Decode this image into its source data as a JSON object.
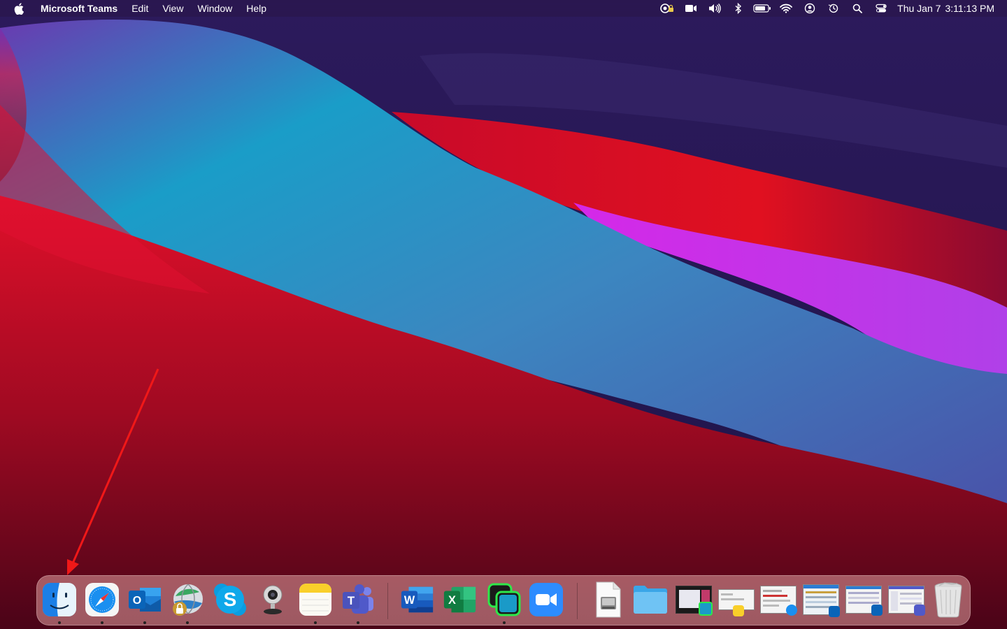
{
  "menubar": {
    "app_name": "Microsoft Teams",
    "menus": [
      "Edit",
      "View",
      "Window",
      "Help"
    ],
    "clock_day": "Thu Jan 7",
    "clock_time": "3:11:13 PM",
    "status_icons": [
      "teams-lock-icon",
      "video-icon",
      "volume-icon",
      "bluetooth-icon",
      "battery-icon",
      "wifi-icon",
      "user-icon",
      "time-machine-icon",
      "search-icon",
      "control-center-icon"
    ]
  },
  "dock": {
    "apps": [
      {
        "name": "finder",
        "running": true
      },
      {
        "name": "safari",
        "running": true
      },
      {
        "name": "outlook",
        "label": "O",
        "running": true
      },
      {
        "name": "vpn-client",
        "running": true
      },
      {
        "name": "skype",
        "label": "S",
        "running": false
      },
      {
        "name": "webcam",
        "running": false
      },
      {
        "name": "notes",
        "running": true
      },
      {
        "name": "teams",
        "label": "T",
        "running": true
      },
      {
        "name": "word",
        "label": "W",
        "running": false
      },
      {
        "name": "excel",
        "label": "X",
        "running": false
      },
      {
        "name": "green-app",
        "running": true
      },
      {
        "name": "zoom",
        "running": false
      }
    ],
    "documents": [
      "disk-image",
      "folder",
      "screenshot-1",
      "window-thumb-1",
      "window-thumb-2",
      "window-thumb-3",
      "window-thumb-4",
      "window-thumb-5",
      "trash"
    ]
  },
  "colors": {
    "accent_red": "#e8112d",
    "teal": "#1aa6c9",
    "violet": "#b53ee6",
    "navy": "#2a1b5a"
  }
}
